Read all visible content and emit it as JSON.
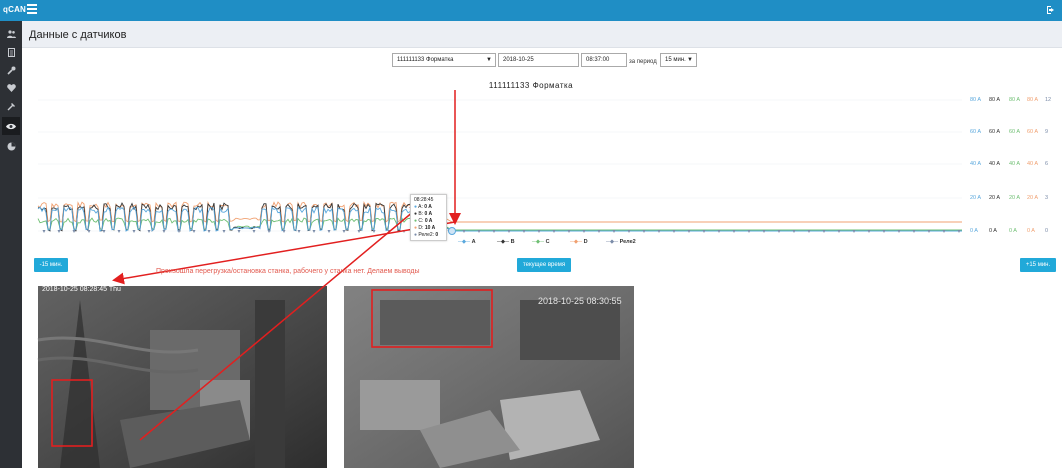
{
  "app": {
    "brand": "qCAN"
  },
  "page": {
    "title": "Данные с датчиков"
  },
  "controls": {
    "device": "111111133 Форматка",
    "date": "2018-10-25",
    "time": "08:37:00",
    "period_label": "за период",
    "period_value": "15 мин."
  },
  "chart": {
    "title": "111111133 Форматка",
    "y_axes": [
      {
        "color": "#5aa8dd",
        "ticks": [
          "80 A",
          "60 A",
          "40 A",
          "20 A",
          "0 A"
        ]
      },
      {
        "color": "#333333",
        "ticks": [
          "80 A",
          "60 A",
          "40 A",
          "20 A",
          "0 A"
        ]
      },
      {
        "color": "#6fbf73",
        "ticks": [
          "80 A",
          "60 A",
          "40 A",
          "20 A",
          "0 A"
        ]
      },
      {
        "color": "#f0a070",
        "ticks": [
          "80 A",
          "60 A",
          "40 A",
          "20 A",
          "0 A"
        ]
      },
      {
        "color": "#7a8ba8",
        "ticks": [
          "12",
          "9",
          "6",
          "3",
          "0"
        ]
      }
    ],
    "legend": [
      {
        "name": "A",
        "color": "#5aa8dd"
      },
      {
        "name": "B",
        "color": "#333333"
      },
      {
        "name": "C",
        "color": "#6fbf73"
      },
      {
        "name": "D",
        "color": "#f0a070"
      },
      {
        "name": "Реле2",
        "color": "#7a8ba8"
      }
    ],
    "tooltip": {
      "time": "08:28:45",
      "rows": [
        {
          "label": "A:",
          "value": "0 A",
          "color": "#5aa8dd"
        },
        {
          "label": "B:",
          "value": "0 A",
          "color": "#333333"
        },
        {
          "label": "C:",
          "value": "0 A",
          "color": "#6fbf73"
        },
        {
          "label": "D:",
          "value": "10 A",
          "color": "#f0a070"
        },
        {
          "label": "Реле2:",
          "value": "0",
          "color": "#7a8ba8"
        }
      ]
    }
  },
  "buttons": {
    "back": "-15 мин.",
    "now": "текущее время",
    "forward": "+15 мин."
  },
  "note": "Произошла перегрузка/остановка станка, рабочего у станка нет. Делаем выводы",
  "cameras": [
    {
      "timestamp": "2018-10-25 08:28:45 Thu"
    },
    {
      "timestamp": "2018-10-25 08:30:55"
    }
  ]
}
